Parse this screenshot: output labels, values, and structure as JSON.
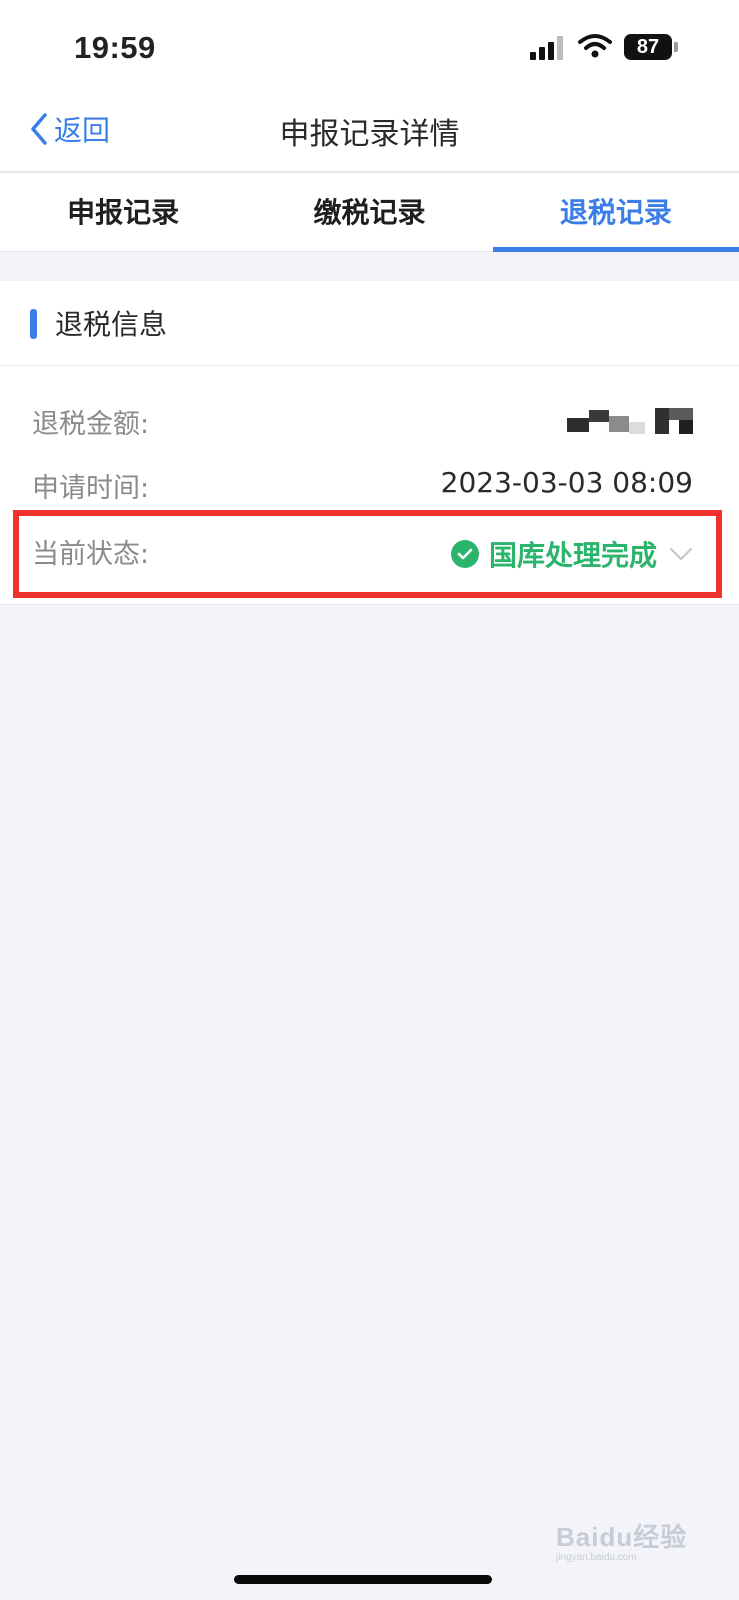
{
  "status_bar": {
    "time": "19:59",
    "battery": "87"
  },
  "navbar": {
    "back_label": "返回",
    "title": "申报记录详情"
  },
  "tabs": [
    {
      "label": "申报记录",
      "active": false
    },
    {
      "label": "缴税记录",
      "active": false
    },
    {
      "label": "退税记录",
      "active": true
    }
  ],
  "section": {
    "title": "退税信息"
  },
  "rows": {
    "refund_amount": {
      "label": "退税金额:"
    },
    "apply_time": {
      "label": "申请时间:",
      "value": "2023-03-03 08:09"
    },
    "current_status": {
      "label": "当前状态:",
      "value": "国库处理完成"
    }
  },
  "colors": {
    "accent": "#3b7ee8",
    "success": "#2bb46c",
    "highlight": "#f0312c"
  },
  "icons": [
    "back-chevron-icon",
    "signal-icon",
    "wifi-icon",
    "battery-icon",
    "check-circle-icon",
    "chevron-down-icon"
  ],
  "watermark": {
    "brand": "Baidu经验",
    "domain": "jingyan.baidu.com"
  }
}
